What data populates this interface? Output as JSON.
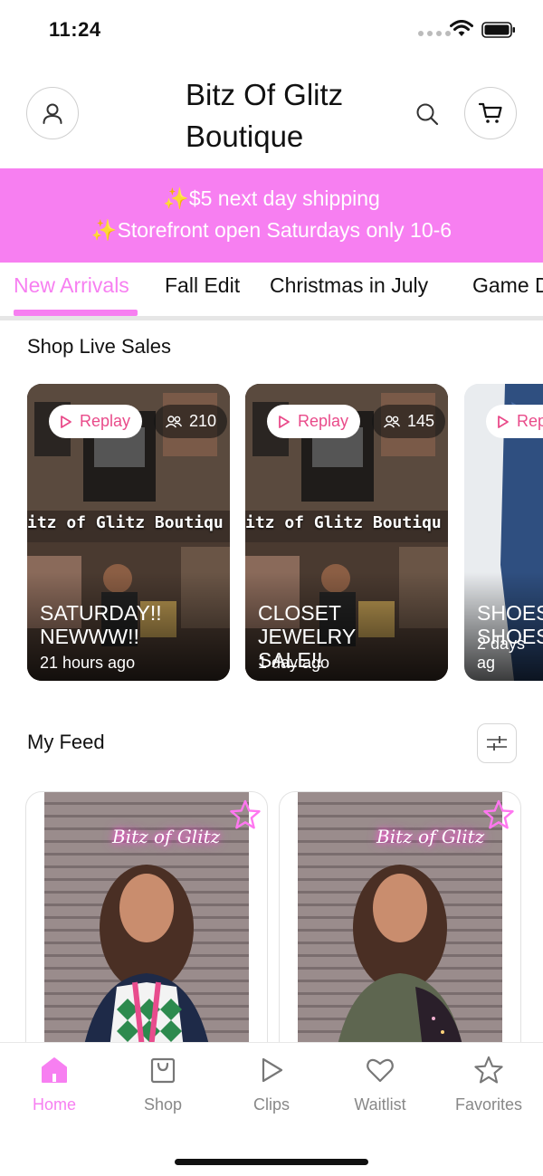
{
  "status_bar": {
    "time": "11:24"
  },
  "header": {
    "title": "Bitz Of Glitz Boutique"
  },
  "banner": {
    "line1": "$5 next day shipping",
    "line2": "Storefront open Saturdays only 10-6",
    "emoji": "✨"
  },
  "tabs": [
    {
      "label": "New Arrivals",
      "active": true
    },
    {
      "label": "Fall Edit"
    },
    {
      "label": "Christmas in July"
    },
    {
      "label": "Game D"
    }
  ],
  "live_sales": {
    "title": "Shop Live Sales",
    "cards": [
      {
        "replay": "Replay",
        "viewers": "210",
        "overlay_text": "itz of Glitz Boutiqu",
        "title_line1": "SATURDAY!!",
        "title_line2": "NEWWW!!",
        "time": "21 hours ago"
      },
      {
        "replay": "Replay",
        "viewers": "145",
        "overlay_text": "itz of Glitz Boutiqu",
        "title_line1": "CLOSET JEWELRY",
        "title_line2": "SALE!!",
        "time": "1 day ago"
      },
      {
        "replay": "Rep",
        "title_line1": "SHOES",
        "title_line2": "SHOES",
        "time": "2 days ag"
      }
    ]
  },
  "feed": {
    "title": "My Feed",
    "neon_sign": "Bitz of Glitz"
  },
  "bottom_nav": [
    {
      "label": "Home",
      "icon": "home-icon",
      "active": true
    },
    {
      "label": "Shop",
      "icon": "shopping-bag-icon"
    },
    {
      "label": "Clips",
      "icon": "play-icon"
    },
    {
      "label": "Waitlist",
      "icon": "heart-icon"
    },
    {
      "label": "Favorites",
      "icon": "star-icon"
    }
  ],
  "colors": {
    "accent": "#f77ff1",
    "replay_text": "#e94b8a",
    "inactive_nav": "#888888"
  }
}
